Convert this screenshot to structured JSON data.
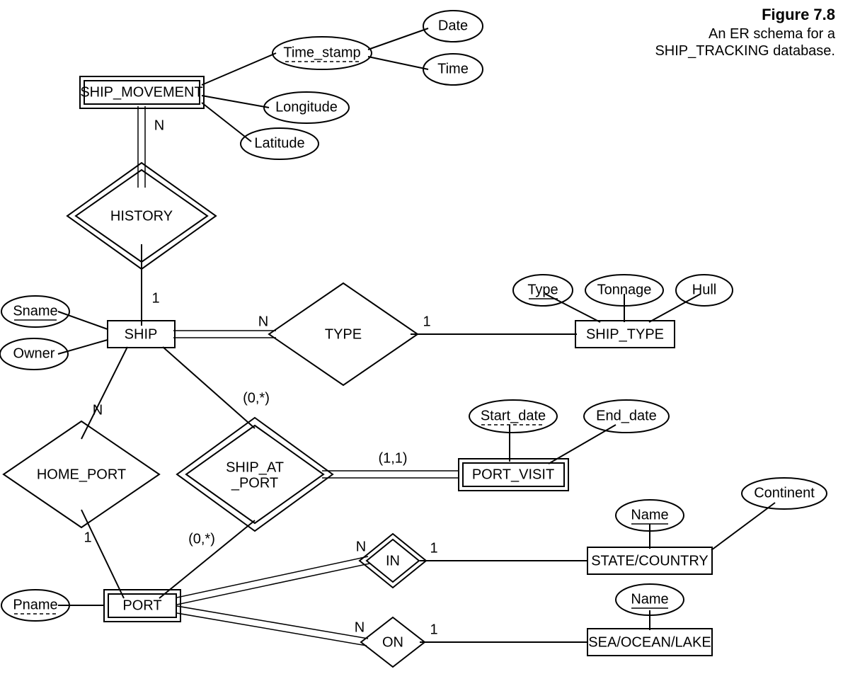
{
  "caption": {
    "title": "Figure 7.8",
    "line1": "An ER schema for a",
    "line2": "SHIP_TRACKING database."
  },
  "entities": {
    "ship_movement": "SHIP_MOVEMENT",
    "ship": "SHIP",
    "ship_type": "SHIP_TYPE",
    "port_visit": "PORT_VISIT",
    "state_country": "STATE/COUNTRY",
    "sea_ocean_lake": "SEA/OCEAN/LAKE",
    "port": "PORT"
  },
  "relationships": {
    "history": "HISTORY",
    "type": "TYPE",
    "home_port": "HOME_PORT",
    "ship_at_port_l1": "SHIP_AT",
    "ship_at_port_l2": "_PORT",
    "in": "IN",
    "on": "ON"
  },
  "attributes": {
    "time_stamp": "Time_stamp",
    "date": "Date",
    "time": "Time",
    "longitude": "Longitude",
    "latitude": "Latitude",
    "sname": "Sname",
    "owner": "Owner",
    "type": "Type",
    "tonnage": "Tonnage",
    "hull": "Hull",
    "start_date": "Start_date",
    "end_date": "End_date",
    "name_sc": "Name",
    "continent": "Continent",
    "name_sol": "Name",
    "pname": "Pname"
  },
  "cardinalities": {
    "history_n": "N",
    "history_1": "1",
    "type_n": "N",
    "type_1": "1",
    "home_port_n": "N",
    "home_port_1": "1",
    "ship_at_port_ship": "(0,*)",
    "ship_at_port_visit": "(1,1)",
    "ship_at_port_port": "(0,*)",
    "in_n": "N",
    "in_1": "1",
    "on_n": "N",
    "on_1": "1"
  }
}
